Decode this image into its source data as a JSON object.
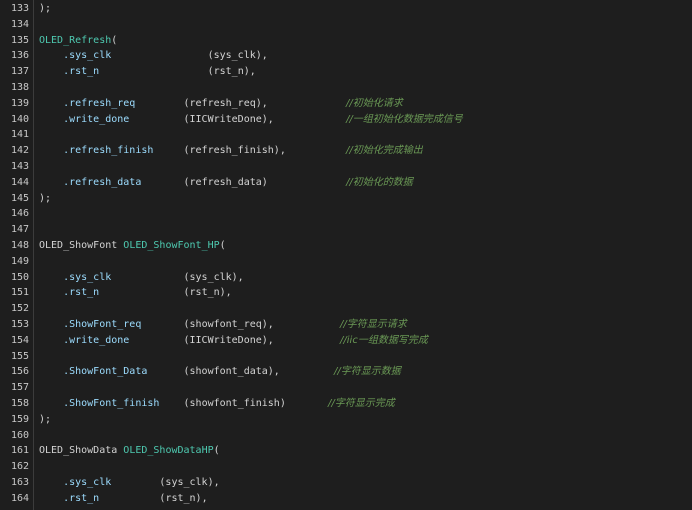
{
  "theme": {
    "background": "#1e1e1e",
    "text": "#d4d4d4",
    "module": "#4ec9b0",
    "port": "#9cdcfe",
    "comment": "#6a9955",
    "line_number": "#c8c8c8"
  },
  "lines": [
    {
      "num": "133",
      "segments": [
        {
          "t": ");",
          "c": "plain"
        }
      ]
    },
    {
      "num": "134",
      "segments": []
    },
    {
      "num": "135",
      "segments": [
        {
          "t": "OLED_Refresh",
          "c": "mod"
        },
        {
          "t": "(",
          "c": "plain"
        }
      ]
    },
    {
      "num": "136",
      "segments": [
        {
          "t": "    .sys_clk",
          "c": "port"
        },
        {
          "t": "                (sys_clk),",
          "c": "plain"
        }
      ]
    },
    {
      "num": "137",
      "segments": [
        {
          "t": "    .rst_n",
          "c": "port"
        },
        {
          "t": "                  (rst_n),",
          "c": "plain"
        }
      ]
    },
    {
      "num": "138",
      "segments": []
    },
    {
      "num": "139",
      "segments": [
        {
          "t": "    .refresh_req",
          "c": "port"
        },
        {
          "t": "        (refresh_req),             ",
          "c": "plain"
        },
        {
          "t": "//初始化请求",
          "c": "cmt"
        }
      ]
    },
    {
      "num": "140",
      "segments": [
        {
          "t": "    .write_done",
          "c": "port"
        },
        {
          "t": "         (IICWriteDone),            ",
          "c": "plain"
        },
        {
          "t": "//一组初始化数据完成信号",
          "c": "cmt"
        }
      ]
    },
    {
      "num": "141",
      "segments": []
    },
    {
      "num": "142",
      "segments": [
        {
          "t": "    .refresh_finish",
          "c": "port"
        },
        {
          "t": "     (refresh_finish),          ",
          "c": "plain"
        },
        {
          "t": "//初始化完成输出",
          "c": "cmt"
        }
      ]
    },
    {
      "num": "143",
      "segments": []
    },
    {
      "num": "144",
      "segments": [
        {
          "t": "    .refresh_data",
          "c": "port"
        },
        {
          "t": "       (refresh_data)             ",
          "c": "plain"
        },
        {
          "t": "//初始化的数据",
          "c": "cmt"
        }
      ]
    },
    {
      "num": "145",
      "segments": [
        {
          "t": ");",
          "c": "plain"
        }
      ]
    },
    {
      "num": "146",
      "segments": []
    },
    {
      "num": "147",
      "segments": []
    },
    {
      "num": "148",
      "segments": [
        {
          "t": "OLED_ShowFont ",
          "c": "plain"
        },
        {
          "t": "OLED_ShowFont_HP",
          "c": "mod"
        },
        {
          "t": "(",
          "c": "plain"
        }
      ]
    },
    {
      "num": "149",
      "segments": []
    },
    {
      "num": "150",
      "segments": [
        {
          "t": "    .sys_clk",
          "c": "port"
        },
        {
          "t": "            (sys_clk),",
          "c": "plain"
        }
      ]
    },
    {
      "num": "151",
      "segments": [
        {
          "t": "    .rst_n",
          "c": "port"
        },
        {
          "t": "              (rst_n),",
          "c": "plain"
        }
      ]
    },
    {
      "num": "152",
      "segments": []
    },
    {
      "num": "153",
      "segments": [
        {
          "t": "    .ShowFont_req",
          "c": "port"
        },
        {
          "t": "       (showfont_req),           ",
          "c": "plain"
        },
        {
          "t": "//字符显示请求",
          "c": "cmt"
        }
      ]
    },
    {
      "num": "154",
      "segments": [
        {
          "t": "    .write_done",
          "c": "port"
        },
        {
          "t": "         (IICWriteDone),           ",
          "c": "plain"
        },
        {
          "t": "//iic一组数据写完成",
          "c": "cmt"
        }
      ]
    },
    {
      "num": "155",
      "segments": []
    },
    {
      "num": "156",
      "segments": [
        {
          "t": "    .ShowFont_Data",
          "c": "port"
        },
        {
          "t": "      (showfont_data),         ",
          "c": "plain"
        },
        {
          "t": "//字符显示数据",
          "c": "cmt"
        }
      ]
    },
    {
      "num": "157",
      "segments": []
    },
    {
      "num": "158",
      "segments": [
        {
          "t": "    .ShowFont_finish",
          "c": "port"
        },
        {
          "t": "    (showfont_finish)       ",
          "c": "plain"
        },
        {
          "t": "//字符显示完成",
          "c": "cmt"
        }
      ]
    },
    {
      "num": "159",
      "segments": [
        {
          "t": ");",
          "c": "plain"
        }
      ]
    },
    {
      "num": "160",
      "segments": []
    },
    {
      "num": "161",
      "segments": [
        {
          "t": "OLED_ShowData ",
          "c": "plain"
        },
        {
          "t": "OLED_ShowDataHP",
          "c": "mod"
        },
        {
          "t": "(",
          "c": "plain"
        }
      ]
    },
    {
      "num": "162",
      "segments": []
    },
    {
      "num": "163",
      "segments": [
        {
          "t": "    .sys_clk",
          "c": "port"
        },
        {
          "t": "        (sys_clk),",
          "c": "plain"
        }
      ]
    },
    {
      "num": "164",
      "segments": [
        {
          "t": "    .rst_n",
          "c": "port"
        },
        {
          "t": "          (rst_n),",
          "c": "plain"
        }
      ]
    }
  ]
}
